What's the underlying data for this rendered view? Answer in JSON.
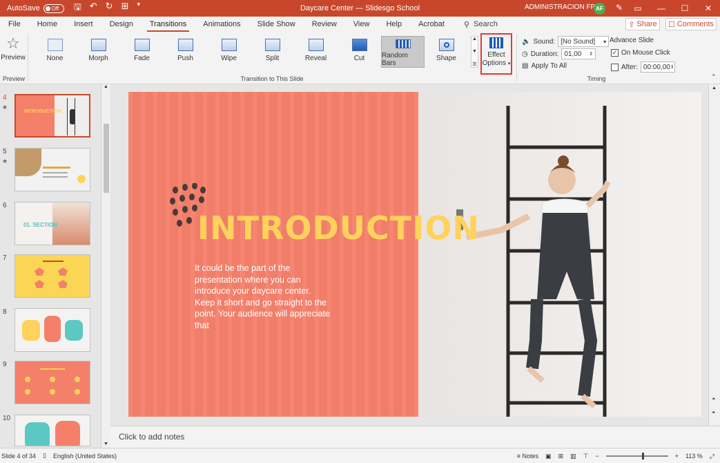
{
  "titlebar": {
    "autosave_label": "AutoSave",
    "autosave_state": "Off",
    "doc_title": "Daycare Center — Slidesgo School",
    "user_name": "ADMINISTRACION FP",
    "user_initials": "AF",
    "accent": "#c8472c"
  },
  "tabs": [
    "File",
    "Home",
    "Insert",
    "Design",
    "Transitions",
    "Animations",
    "Slide Show",
    "Review",
    "View",
    "Help",
    "Acrobat"
  ],
  "active_tab": "Transitions",
  "search_label": "Search",
  "share_label": "Share",
  "comments_label": "Comments",
  "ribbon": {
    "preview_label": "Preview",
    "preview_group": "Preview",
    "transitions": [
      "None",
      "Morph",
      "Fade",
      "Push",
      "Wipe",
      "Split",
      "Reveal",
      "Cut",
      "Random Bars",
      "Shape"
    ],
    "selected_transition": "Random Bars",
    "group_transition": "Transition to This Slide",
    "effect_options_line1": "Effect",
    "effect_options_line2": "Options",
    "timing": {
      "sound_label": "Sound:",
      "sound_value": "[No Sound]",
      "duration_label": "Duration:",
      "duration_value": "01,00",
      "apply_all_label": "Apply To All",
      "advance_label": "Advance Slide",
      "on_click_label": "On Mouse Click",
      "on_click_checked": true,
      "after_label": "After:",
      "after_value": "00:00,00",
      "after_checked": false,
      "group_label": "Timing"
    }
  },
  "slides_panel": {
    "items": [
      {
        "num": "4",
        "star": "★",
        "selected": true
      },
      {
        "num": "5",
        "star": "★",
        "selected": false
      },
      {
        "num": "6",
        "star": "",
        "selected": false
      },
      {
        "num": "7",
        "star": "",
        "selected": false
      },
      {
        "num": "8",
        "star": "",
        "selected": false
      },
      {
        "num": "9",
        "star": "",
        "selected": false
      },
      {
        "num": "10",
        "star": "",
        "selected": false
      }
    ],
    "thumb_texts": {
      "t4": "INTRODUCTION",
      "t6": "01. SECTION"
    }
  },
  "slide": {
    "title": "INTRODUCTION",
    "body": "It could be the part of the presentation where you can introduce your daycare center. Keep it short and go straight to the point. Your audience will appreciate that"
  },
  "notes_placeholder": "Click to add notes",
  "statusbar": {
    "slide_info": "Slide 4 of 34",
    "language": "English (United States)",
    "notes_label": "Notes",
    "zoom": "113 %"
  }
}
